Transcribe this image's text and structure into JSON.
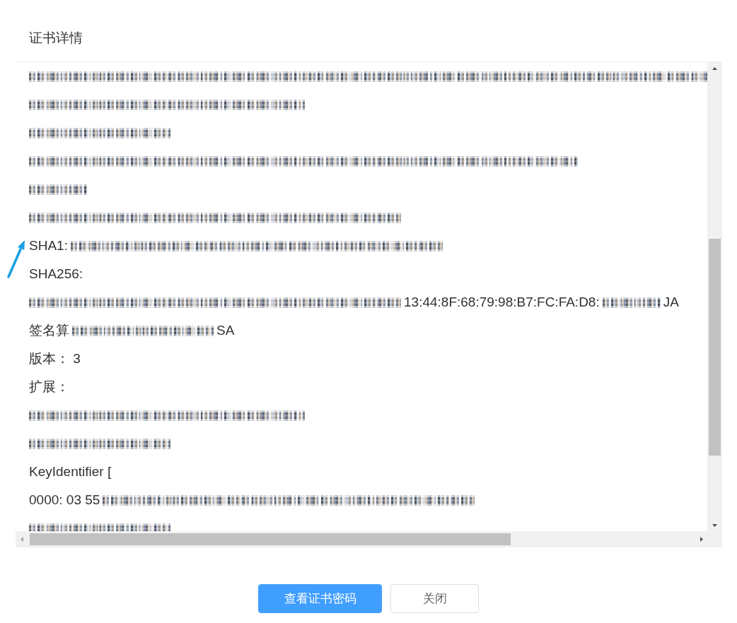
{
  "dialog": {
    "title": "证书详情"
  },
  "certificate_lines": [
    {
      "segments": [
        {
          "kind": "mask_full"
        }
      ]
    },
    {
      "segments": [
        {
          "kind": "mask_medium"
        }
      ]
    },
    {
      "segments": [
        {
          "kind": "mask_small"
        }
      ]
    },
    {
      "segments": [
        {
          "kind": "mask_xlarge"
        }
      ]
    },
    {
      "segments": [
        {
          "kind": "mask_tiny"
        }
      ]
    },
    {
      "segments": [
        {
          "kind": "mask_large"
        }
      ]
    },
    {
      "segments": [
        {
          "kind": "text",
          "text": "SHA1:"
        },
        {
          "kind": "mask_large"
        }
      ]
    },
    {
      "segments": [
        {
          "kind": "text",
          "text": "SHA256:"
        }
      ]
    },
    {
      "segments": [
        {
          "kind": "mask_large"
        },
        {
          "kind": "text",
          "text": "13:44:8F:68:79:98:B7:FC:FA:D8:"
        },
        {
          "kind": "mask_tiny"
        },
        {
          "kind": "text",
          "text": "JA"
        }
      ]
    },
    {
      "segments": [
        {
          "kind": "text",
          "text": "签名算"
        },
        {
          "kind": "mask_small"
        },
        {
          "kind": "text",
          "text": "SA"
        }
      ]
    },
    {
      "segments": [
        {
          "kind": "text",
          "text": "版本： 3"
        }
      ]
    },
    {
      "segments": [
        {
          "kind": "text",
          "text": "扩展："
        }
      ]
    },
    {
      "segments": [
        {
          "kind": "mask_medium"
        }
      ]
    },
    {
      "segments": [
        {
          "kind": "mask_small"
        }
      ]
    },
    {
      "segments": [
        {
          "kind": "text",
          "text": "KeyIdentifier ["
        }
      ]
    },
    {
      "segments": [
        {
          "kind": "text",
          "text": "0000: 03 55"
        },
        {
          "kind": "mask_large"
        }
      ]
    },
    {
      "segments": [
        {
          "kind": "mask_small"
        }
      ]
    }
  ],
  "annotations": [
    {
      "kind": "arrow"
    }
  ],
  "buttons": [
    {
      "label": "查看证书密码",
      "kind": "primary"
    },
    {
      "label": "关闭",
      "kind": "default"
    }
  ]
}
